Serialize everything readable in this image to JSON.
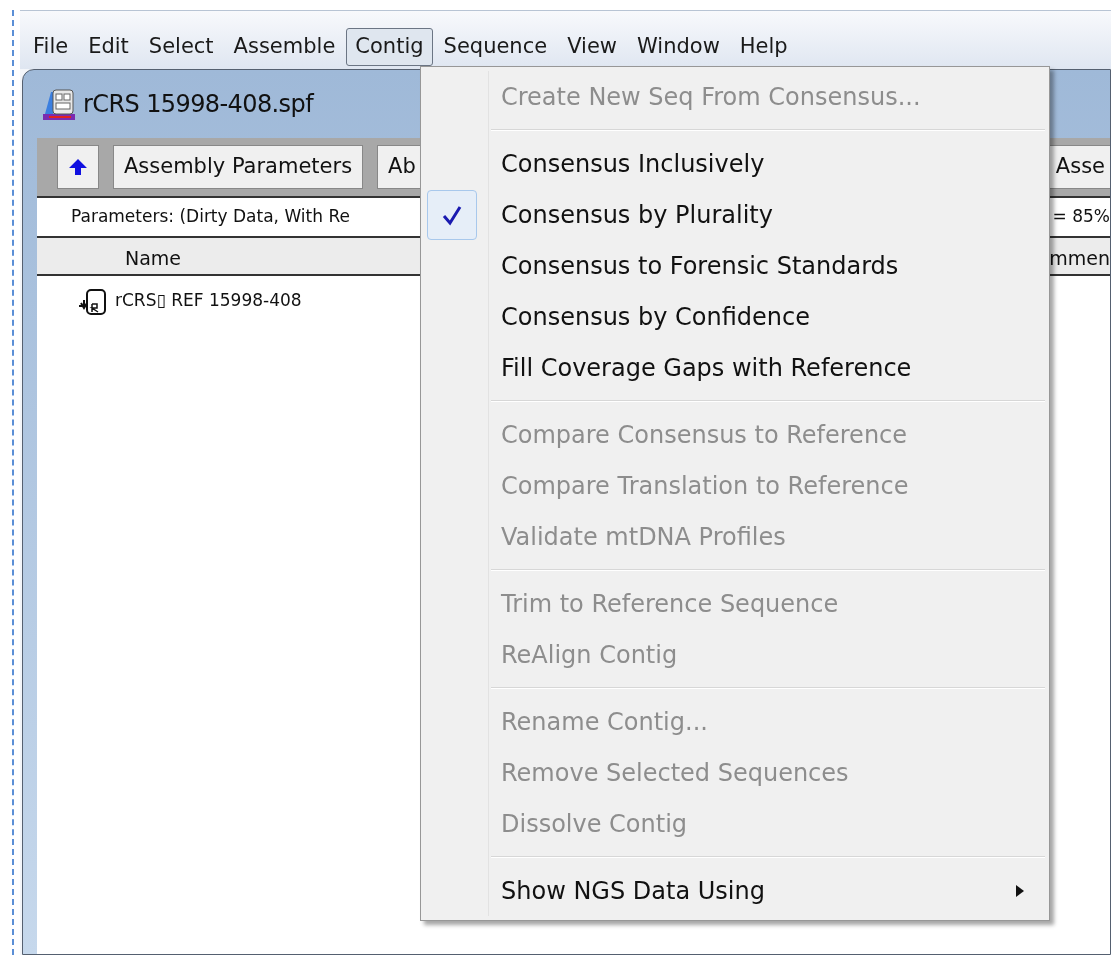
{
  "menubar": [
    {
      "label": "File",
      "selected": false
    },
    {
      "label": "Edit",
      "selected": false
    },
    {
      "label": "Select",
      "selected": false
    },
    {
      "label": "Assemble",
      "selected": false
    },
    {
      "label": "Contig",
      "selected": true
    },
    {
      "label": "Sequence",
      "selected": false
    },
    {
      "label": "View",
      "selected": false
    },
    {
      "label": "Window",
      "selected": false
    },
    {
      "label": "Help",
      "selected": false
    }
  ],
  "document": {
    "title": "rCRS 15998-408.spf",
    "toolbar": {
      "left_buttons": [
        "Assembly Parameters",
        "Ab"
      ],
      "right_buttons": [
        "Asse"
      ]
    },
    "parameters": {
      "left": "Parameters: (Dirty Data, With Re",
      "right": "= 85%"
    },
    "columns": {
      "left": "Name",
      "right": "mmen"
    },
    "rows": [
      {
        "name": "rCRS▯ REF 15998-408"
      }
    ]
  },
  "menu": [
    {
      "kind": "item",
      "label": "Create New Seq From Consensus...",
      "disabled": true,
      "checked": false,
      "submenu": false
    },
    {
      "kind": "separator"
    },
    {
      "kind": "item",
      "label": "Consensus Inclusively",
      "disabled": false,
      "checked": false,
      "submenu": false
    },
    {
      "kind": "item",
      "label": "Consensus by Plurality",
      "disabled": false,
      "checked": true,
      "submenu": false
    },
    {
      "kind": "item",
      "label": "Consensus to Forensic Standards",
      "disabled": false,
      "checked": false,
      "submenu": false
    },
    {
      "kind": "item",
      "label": "Consensus by Confidence",
      "disabled": false,
      "checked": false,
      "submenu": false
    },
    {
      "kind": "item",
      "label": "Fill Coverage Gaps with Reference",
      "disabled": false,
      "checked": false,
      "submenu": false
    },
    {
      "kind": "separator"
    },
    {
      "kind": "item",
      "label": "Compare Consensus to Reference",
      "disabled": true,
      "checked": false,
      "submenu": false
    },
    {
      "kind": "item",
      "label": "Compare Translation to Reference",
      "disabled": true,
      "checked": false,
      "submenu": false
    },
    {
      "kind": "item",
      "label": "Validate mtDNA Profiles",
      "disabled": true,
      "checked": false,
      "submenu": false
    },
    {
      "kind": "separator"
    },
    {
      "kind": "item",
      "label": "Trim to Reference Sequence",
      "disabled": true,
      "checked": false,
      "submenu": false
    },
    {
      "kind": "item",
      "label": "ReAlign Contig",
      "disabled": true,
      "checked": false,
      "submenu": false
    },
    {
      "kind": "separator"
    },
    {
      "kind": "item",
      "label": "Rename Contig...",
      "disabled": true,
      "checked": false,
      "submenu": false
    },
    {
      "kind": "item",
      "label": "Remove Selected Sequences",
      "disabled": true,
      "checked": false,
      "submenu": false
    },
    {
      "kind": "item",
      "label": "Dissolve Contig",
      "disabled": true,
      "checked": false,
      "submenu": false
    },
    {
      "kind": "separator"
    },
    {
      "kind": "item",
      "label": "Show NGS Data Using",
      "disabled": false,
      "checked": false,
      "submenu": true
    }
  ]
}
